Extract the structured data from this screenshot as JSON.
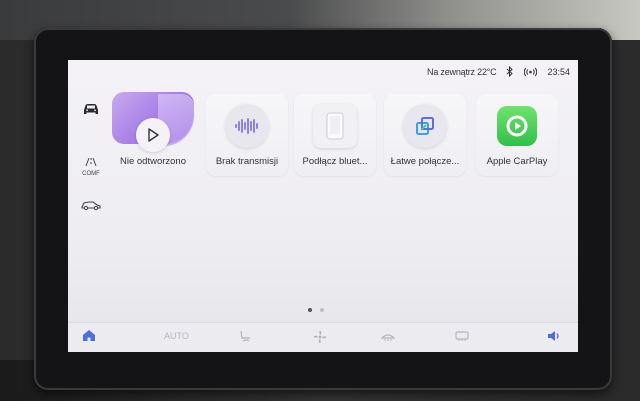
{
  "status": {
    "outside_temp": "Na zewnątrz 22°C",
    "time": "23:54",
    "icons": [
      "bluetooth-icon",
      "wireless-icon"
    ]
  },
  "rail": {
    "items": [
      {
        "name": "car",
        "icon": "car-icon",
        "label": ""
      },
      {
        "name": "comf",
        "icon": "comfort-icon",
        "label": "COMF"
      },
      {
        "name": "car-side",
        "icon": "car-side-icon",
        "label": ""
      }
    ]
  },
  "tiles": [
    {
      "label": "Nie odtworzono",
      "icon": "play-icon"
    },
    {
      "label": "Brak transmisji",
      "icon": "waveform-icon"
    },
    {
      "label": "Podłącz bluet...",
      "icon": "phone-icon"
    },
    {
      "label": "Łatwe połącze...",
      "icon": "screen-mirror-icon"
    },
    {
      "label": "Apple CarPlay",
      "icon": "carplay-icon"
    }
  ],
  "pager": {
    "pages": 2,
    "current": 1
  },
  "bottombar": {
    "auto_label": "AUTO",
    "items": [
      "home-icon",
      "auto",
      "seat-heat-icon",
      "fan-icon",
      "defrost-front-icon",
      "defrost-rear-icon",
      "volume-icon"
    ]
  },
  "colors": {
    "accent": "#4a6fe0",
    "media_art": "#a880e6",
    "carplay_green": "#3cc64f"
  }
}
